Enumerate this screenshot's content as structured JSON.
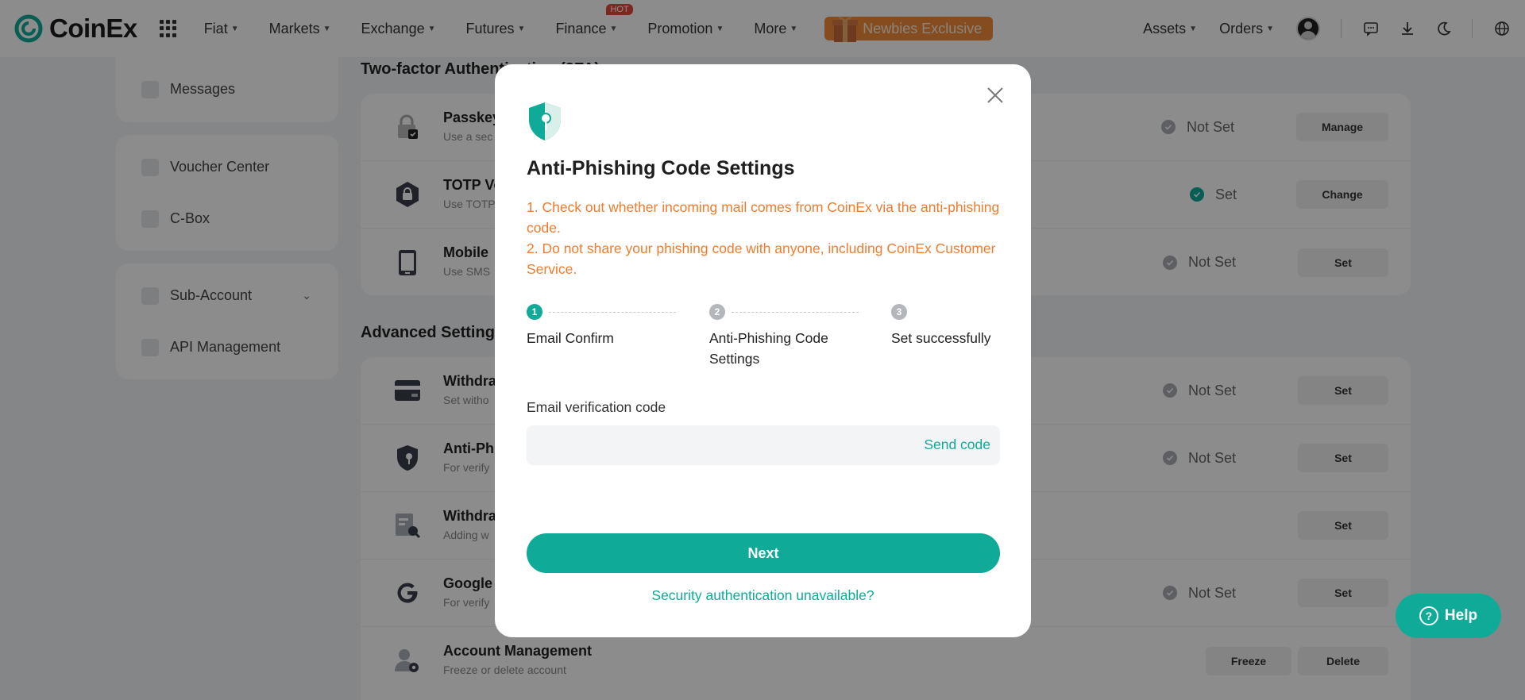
{
  "brand": {
    "name": "CoinEx",
    "accent": "#0fab98"
  },
  "nav": {
    "items": [
      {
        "label": "Fiat"
      },
      {
        "label": "Markets"
      },
      {
        "label": "Exchange"
      },
      {
        "label": "Futures"
      },
      {
        "label": "Finance",
        "badge": "HOT"
      },
      {
        "label": "Promotion"
      },
      {
        "label": "More"
      }
    ],
    "promo": "Newbies Exclusive",
    "right": [
      {
        "label": "Assets"
      },
      {
        "label": "Orders"
      }
    ]
  },
  "sidebar": {
    "group1": [
      {
        "label": "Messages"
      }
    ],
    "group2": [
      {
        "label": "Voucher Center"
      },
      {
        "label": "C-Box"
      }
    ],
    "group3": [
      {
        "label": "Sub-Account"
      },
      {
        "label": "API Management"
      }
    ]
  },
  "twofa": {
    "title": "Two-factor Authentication (2FA)",
    "rows": [
      {
        "title": "Passkey",
        "sub": "Use a sec",
        "status": "Not Set",
        "action": "Manage"
      },
      {
        "title": "TOTP Ve",
        "sub": "Use TOTP",
        "status": "Set",
        "action": "Change"
      },
      {
        "title": "Mobile",
        "sub": "Use SMS",
        "status": "Not Set",
        "action": "Set"
      }
    ]
  },
  "advanced": {
    "title": "Advanced Settings",
    "rows": [
      {
        "title": "Withdra",
        "sub": "Set witho",
        "status": "Not Set",
        "action": "Set"
      },
      {
        "title": "Anti-Ph",
        "sub": "For verify",
        "status": "Not Set",
        "action": "Set"
      },
      {
        "title": "Withdra",
        "sub": "Adding w",
        "status": "",
        "action": "Set"
      },
      {
        "title": "Google",
        "sub": "For verify",
        "status": "Not Set",
        "action": "Set"
      },
      {
        "title": "Account Management",
        "sub": "Freeze or delete account",
        "action1": "Freeze",
        "action2": "Delete"
      }
    ]
  },
  "modal": {
    "title": "Anti-Phishing Code Settings",
    "notes": [
      "1. Check out whether incoming mail comes from CoinEx via the anti-phishing code.",
      "2. Do not share your phishing code with anyone, including CoinEx Customer Service."
    ],
    "steps": [
      {
        "num": "1",
        "label": "Email Confirm"
      },
      {
        "num": "2",
        "label": "Anti-Phishing Code Settings"
      },
      {
        "num": "3",
        "label": "Set successfully"
      }
    ],
    "field_label": "Email verification code",
    "field_value": "",
    "send_code": "Send code",
    "next": "Next",
    "unavailable": "Security authentication unavailable?"
  },
  "help": {
    "label": "Help"
  }
}
